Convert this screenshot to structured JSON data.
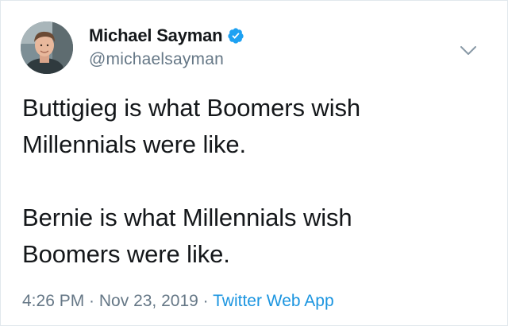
{
  "author": {
    "display_name": "Michael Sayman",
    "handle": "@michaelsayman",
    "verified": true,
    "avatar_icon": "profile-photo"
  },
  "tweet": {
    "paragraphs": [
      "Buttigieg is what Boomers wish\nMillennials were like.",
      "Bernie is what Millennials wish\nBoomers were like."
    ]
  },
  "meta": {
    "time": "4:26 PM",
    "separator1": " · ",
    "date": "Nov 23, 2019",
    "separator2": " · ",
    "source": "Twitter Web App"
  },
  "colors": {
    "text": "#14171a",
    "secondary": "#657786",
    "link": "#1b95e0",
    "verified": "#1da1f2"
  },
  "icons": {
    "menu": "chevron-down-icon",
    "verified": "verified-badge-icon"
  }
}
